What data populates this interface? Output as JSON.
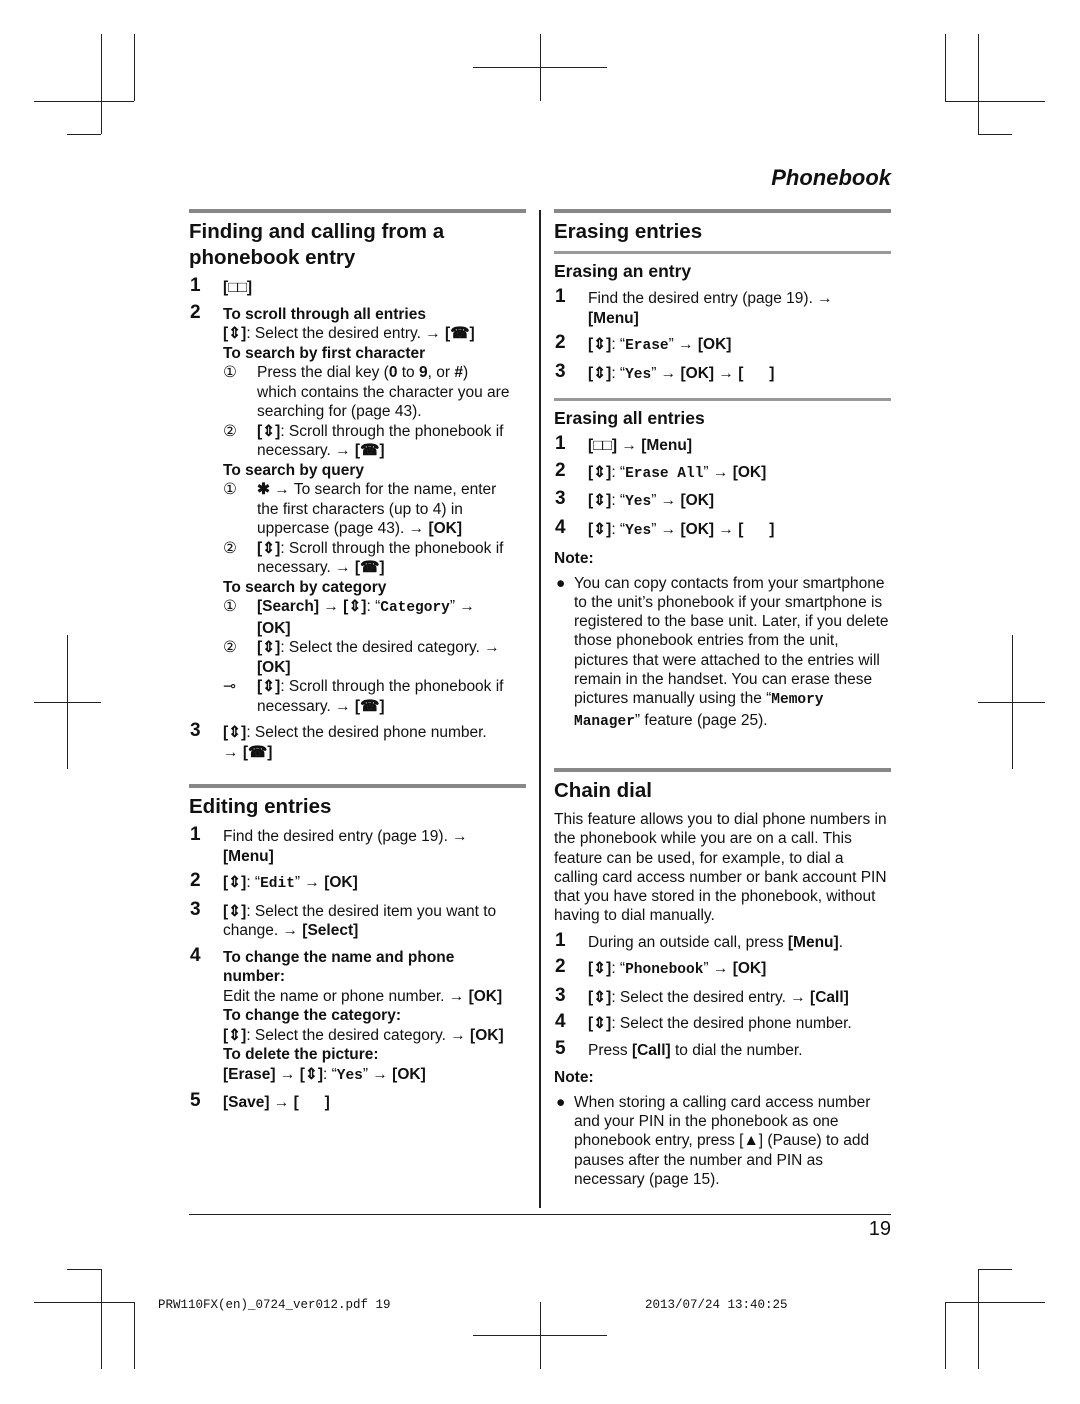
{
  "header": {
    "title": "Phonebook"
  },
  "left": [
    {
      "title": [
        "Finding and calling from a",
        "phonebook entry"
      ],
      "steps": [
        {
          "num": "1",
          "lines": [
            {
              "s": [
                [
                  "b",
                  "[□□]"
                ]
              ]
            }
          ]
        },
        {
          "num": "2",
          "lines": [
            {
              "s": [
                [
                  "b",
                  "To scroll through all entries"
                ]
              ]
            },
            {
              "s": [
                [
                  "b",
                  "[⇕]"
                ],
                [
                  "t",
                  ": Select the desired entry. → "
                ],
                [
                  "b",
                  "[☎]"
                ]
              ]
            },
            {
              "s": [
                [
                  "b",
                  "To search by first character"
                ]
              ]
            },
            {
              "mk": "①",
              "sub": true,
              "s": [
                [
                  "t",
                  "Press the dial key ("
                ],
                [
                  "b",
                  "0"
                ],
                [
                  "t",
                  " to "
                ],
                [
                  "b",
                  "9"
                ],
                [
                  "t",
                  ", or "
                ],
                [
                  "b",
                  "#"
                ],
                [
                  "t",
                  ")"
                ]
              ]
            },
            {
              "sub": true,
              "s": [
                [
                  "t",
                  "which contains the character you are"
                ]
              ]
            },
            {
              "sub": true,
              "s": [
                [
                  "t",
                  "searching for (page 43)."
                ]
              ]
            },
            {
              "mk": "②",
              "sub": true,
              "s": [
                [
                  "b",
                  "[⇕]"
                ],
                [
                  "t",
                  ": Scroll through the phonebook if"
                ]
              ]
            },
            {
              "sub": true,
              "s": [
                [
                  "t",
                  "necessary. → "
                ],
                [
                  "b",
                  "[☎]"
                ]
              ]
            },
            {
              "s": [
                [
                  "b",
                  "To search by query"
                ]
              ]
            },
            {
              "mk": "①",
              "sub": true,
              "s": [
                [
                  "b",
                  "✱"
                ],
                [
                  "t",
                  " → To search for the name, enter"
                ]
              ]
            },
            {
              "sub": true,
              "s": [
                [
                  "t",
                  "the first characters (up to 4) in"
                ]
              ]
            },
            {
              "sub": true,
              "s": [
                [
                  "t",
                  "uppercase (page 43). → "
                ],
                [
                  "b",
                  "[OK]"
                ]
              ]
            },
            {
              "mk": "②",
              "sub": true,
              "s": [
                [
                  "b",
                  "[⇕]"
                ],
                [
                  "t",
                  ": Scroll through the phonebook if"
                ]
              ]
            },
            {
              "sub": true,
              "s": [
                [
                  "t",
                  "necessary. → "
                ],
                [
                  "b",
                  "[☎]"
                ]
              ]
            },
            {
              "s": [
                [
                  "b",
                  "To search by category"
                ]
              ]
            },
            {
              "mk": "①",
              "sub": true,
              "s": [
                [
                  "b",
                  "[Search]"
                ],
                [
                  "t",
                  " → "
                ],
                [
                  "b",
                  "[⇕]"
                ],
                [
                  "t",
                  ": “"
                ],
                [
                  "m",
                  "Category"
                ],
                [
                  "t",
                  "” →"
                ]
              ]
            },
            {
              "sub": true,
              "s": [
                [
                  "b",
                  "[OK]"
                ]
              ]
            },
            {
              "mk": "②",
              "sub": true,
              "s": [
                [
                  "b",
                  "[⇕]"
                ],
                [
                  "t",
                  ": Select the desired category. →"
                ]
              ]
            },
            {
              "sub": true,
              "s": [
                [
                  "b",
                  "[OK]"
                ]
              ]
            },
            {
              "mk": "⊸",
              "sub": true,
              "s": [
                [
                  "b",
                  "[⇕]"
                ],
                [
                  "t",
                  ": Scroll through the phonebook if"
                ]
              ]
            },
            {
              "sub": true,
              "s": [
                [
                  "t",
                  "necessary. → "
                ],
                [
                  "b",
                  "[☎]"
                ]
              ]
            }
          ]
        },
        {
          "num": "3",
          "lines": [
            {
              "s": [
                [
                  "b",
                  "[⇕]"
                ],
                [
                  "t",
                  ": Select the desired phone number."
                ]
              ]
            },
            {
              "s": [
                [
                  "t",
                  "→ "
                ],
                [
                  "b",
                  "[☎]"
                ]
              ]
            }
          ]
        }
      ]
    },
    {
      "title": [
        "Editing entries"
      ],
      "steps": [
        {
          "num": "1",
          "lines": [
            {
              "s": [
                [
                  "t",
                  "Find the desired entry (page 19). →"
                ]
              ]
            },
            {
              "s": [
                [
                  "b",
                  "[Menu]"
                ]
              ]
            }
          ]
        },
        {
          "num": "2",
          "lines": [
            {
              "s": [
                [
                  "b",
                  "[⇕]"
                ],
                [
                  "t",
                  ": “"
                ],
                [
                  "m",
                  "Edit"
                ],
                [
                  "t",
                  "” → "
                ],
                [
                  "b",
                  "[OK]"
                ]
              ]
            }
          ]
        },
        {
          "num": "3",
          "lines": [
            {
              "s": [
                [
                  "b",
                  "[⇕]"
                ],
                [
                  "t",
                  ": Select the desired item you want to"
                ]
              ]
            },
            {
              "s": [
                [
                  "t",
                  "change. → "
                ],
                [
                  "b",
                  "[Select]"
                ]
              ]
            }
          ]
        },
        {
          "num": "4",
          "lines": [
            {
              "s": [
                [
                  "b",
                  "To change the name and phone"
                ]
              ]
            },
            {
              "s": [
                [
                  "b",
                  "number:"
                ]
              ]
            },
            {
              "s": [
                [
                  "t",
                  "Edit the name or phone number. → "
                ],
                [
                  "b",
                  "[OK]"
                ]
              ]
            },
            {
              "s": [
                [
                  "b",
                  "To change the category:"
                ]
              ]
            },
            {
              "s": [
                [
                  "b",
                  "[⇕]"
                ],
                [
                  "t",
                  ": Select the desired category. → "
                ],
                [
                  "b",
                  "[OK]"
                ]
              ]
            },
            {
              "s": [
                [
                  "b",
                  "To delete the picture:"
                ]
              ]
            },
            {
              "s": [
                [
                  "b",
                  "[Erase]"
                ],
                [
                  "t",
                  " → "
                ],
                [
                  "b",
                  "[⇕]"
                ],
                [
                  "t",
                  ": “"
                ],
                [
                  "m",
                  "Yes"
                ],
                [
                  "t",
                  "” → "
                ],
                [
                  "b",
                  "[OK]"
                ]
              ]
            }
          ]
        },
        {
          "num": "5",
          "lines": [
            {
              "s": [
                [
                  "b",
                  "[Save]"
                ],
                [
                  "t",
                  " → "
                ],
                [
                  "b",
                  "[      ]"
                ]
              ]
            }
          ]
        }
      ]
    }
  ],
  "right": {
    "erasing": {
      "title": "Erasing entries",
      "sub1": {
        "title": "Erasing an entry",
        "steps": [
          {
            "num": "1",
            "lines": [
              {
                "s": [
                  [
                    "t",
                    "Find the desired entry (page 19). →"
                  ]
                ]
              },
              {
                "s": [
                  [
                    "b",
                    "[Menu]"
                  ]
                ]
              }
            ]
          },
          {
            "num": "2",
            "lines": [
              {
                "s": [
                  [
                    "b",
                    "[⇕]"
                  ],
                  [
                    "t",
                    ": “"
                  ],
                  [
                    "m",
                    "Erase"
                  ],
                  [
                    "t",
                    "” → "
                  ],
                  [
                    "b",
                    "[OK]"
                  ]
                ]
              }
            ]
          },
          {
            "num": "3",
            "lines": [
              {
                "s": [
                  [
                    "b",
                    "[⇕]"
                  ],
                  [
                    "t",
                    ": “"
                  ],
                  [
                    "m",
                    "Yes"
                  ],
                  [
                    "t",
                    "” → "
                  ],
                  [
                    "b",
                    "[OK]"
                  ],
                  [
                    "t",
                    " → "
                  ],
                  [
                    "b",
                    "[      ]"
                  ]
                ]
              }
            ]
          }
        ]
      },
      "sub2": {
        "title": "Erasing all entries",
        "steps": [
          {
            "num": "1",
            "lines": [
              {
                "s": [
                  [
                    "b",
                    "[□□]"
                  ],
                  [
                    "t",
                    " → "
                  ],
                  [
                    "b",
                    "[Menu]"
                  ]
                ]
              }
            ]
          },
          {
            "num": "2",
            "lines": [
              {
                "s": [
                  [
                    "b",
                    "[⇕]"
                  ],
                  [
                    "t",
                    ": “"
                  ],
                  [
                    "m",
                    "Erase All"
                  ],
                  [
                    "t",
                    "” → "
                  ],
                  [
                    "b",
                    "[OK]"
                  ]
                ]
              }
            ]
          },
          {
            "num": "3",
            "lines": [
              {
                "s": [
                  [
                    "b",
                    "[⇕]"
                  ],
                  [
                    "t",
                    ": “"
                  ],
                  [
                    "m",
                    "Yes"
                  ],
                  [
                    "t",
                    "” → "
                  ],
                  [
                    "b",
                    "[OK]"
                  ]
                ]
              }
            ]
          },
          {
            "num": "4",
            "lines": [
              {
                "s": [
                  [
                    "b",
                    "[⇕]"
                  ],
                  [
                    "t",
                    ": “"
                  ],
                  [
                    "m",
                    "Yes"
                  ],
                  [
                    "t",
                    "” → "
                  ],
                  [
                    "b",
                    "[OK]"
                  ],
                  [
                    "t",
                    " → "
                  ],
                  [
                    "b",
                    "[      ]"
                  ]
                ]
              }
            ]
          }
        ]
      },
      "note_label": "Note:",
      "note": "You can copy contacts from your smartphone to the unit’s phonebook if your smartphone is registered to the base unit. Later, if you delete those phonebook entries from the unit, pictures that were attached to the entries will remain in the handset. You can erase these pictures manually using the “",
      "note_mono": "Memory Manager",
      "note_end": "” feature (page 25)."
    },
    "chain": {
      "title": "Chain dial",
      "intro": "This feature allows you to dial phone numbers in the phonebook while you are on a call. This feature can be used, for example, to dial a calling card access number or bank account PIN that you have stored in the phonebook, without having to dial manually.",
      "steps": [
        {
          "num": "1",
          "lines": [
            {
              "s": [
                [
                  "t",
                  "During an outside call, press "
                ],
                [
                  "b",
                  "[Menu]"
                ],
                [
                  "t",
                  "."
                ]
              ]
            }
          ]
        },
        {
          "num": "2",
          "lines": [
            {
              "s": [
                [
                  "b",
                  "[⇕]"
                ],
                [
                  "t",
                  ": “"
                ],
                [
                  "m",
                  "Phonebook"
                ],
                [
                  "t",
                  "” → "
                ],
                [
                  "b",
                  "[OK]"
                ]
              ]
            }
          ]
        },
        {
          "num": "3",
          "lines": [
            {
              "s": [
                [
                  "b",
                  "[⇕]"
                ],
                [
                  "t",
                  ": Select the desired entry. → "
                ],
                [
                  "b",
                  "[Call]"
                ]
              ]
            }
          ]
        },
        {
          "num": "4",
          "lines": [
            {
              "s": [
                [
                  "b",
                  "[⇕]"
                ],
                [
                  "t",
                  ": Select the desired phone number."
                ]
              ]
            }
          ]
        },
        {
          "num": "5",
          "lines": [
            {
              "s": [
                [
                  "t",
                  "Press "
                ],
                [
                  "b",
                  "[Call]"
                ],
                [
                  "t",
                  " to dial the number."
                ]
              ]
            }
          ]
        }
      ],
      "note_label": "Note:",
      "note": "When storing a calling card access number and your PIN in the phonebook as one phonebook entry, press [▲] (Pause) to add pauses after the number and PIN as necessary (page 15)."
    }
  },
  "page_number": "19",
  "footer": {
    "file": "PRW110FX(en)_0724_ver012.pdf   19",
    "date": "2013/07/24   13:40:25"
  }
}
